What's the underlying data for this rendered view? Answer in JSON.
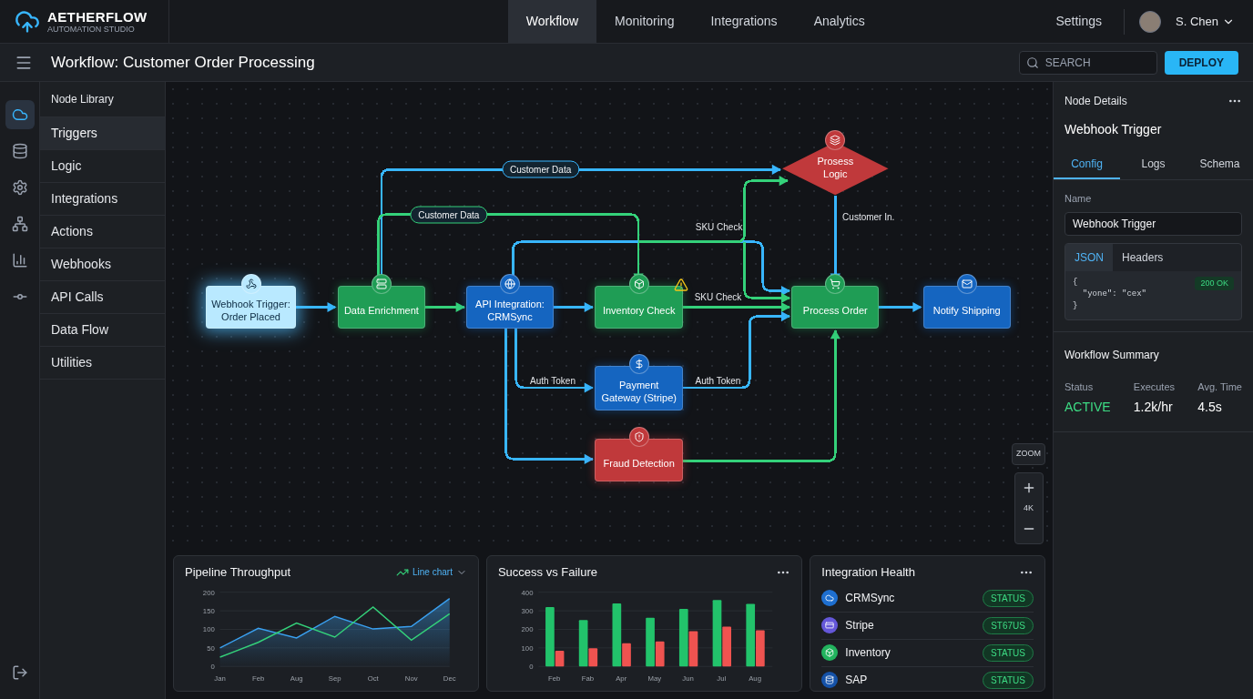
{
  "brand": {
    "name": "AETHERFLOW",
    "tagline": "AUTOMATION STUDIO"
  },
  "nav": [
    {
      "label": "Workflow",
      "selected": true
    },
    {
      "label": "Monitoring",
      "selected": false
    },
    {
      "label": "Integrations",
      "selected": false
    },
    {
      "label": "Analytics",
      "selected": false
    }
  ],
  "header_right": {
    "settings": "Settings",
    "user": "S. Chen"
  },
  "toolbar": {
    "title": "Workflow: Customer Order Processing",
    "search": {
      "placeholder": "SEARCH"
    },
    "deploy": "DEPLOY"
  },
  "rail": [
    {
      "selected": true
    },
    {
      "selected": false
    },
    {
      "selected": false
    },
    {
      "selected": false
    },
    {
      "selected": false
    },
    {
      "selected": false
    }
  ],
  "node_library": {
    "title": "Node Library",
    "items": [
      {
        "label": "Triggers",
        "selected": true
      },
      {
        "label": "Logic",
        "selected": false
      },
      {
        "label": "Integrations",
        "selected": false
      },
      {
        "label": "Actions",
        "selected": false
      },
      {
        "label": "Webhooks",
        "selected": false
      },
      {
        "label": "API Calls",
        "selected": false
      },
      {
        "label": "Data Flow",
        "selected": false
      },
      {
        "label": "Utilities",
        "selected": false
      }
    ]
  },
  "canvas": {
    "nodes": [
      {
        "kind": "rect",
        "label": "Webhook Trigger: Order Placed",
        "color": "#b9e9ff",
        "selected": true,
        "warning": false
      },
      {
        "kind": "rect",
        "label": "Data Enrichment",
        "color": "#1f9d55",
        "selected": false,
        "warning": false
      },
      {
        "kind": "rect",
        "label": "API Integration: CRMSync",
        "color": "#1565c0",
        "selected": false,
        "warning": false
      },
      {
        "kind": "rect",
        "label": "Inventory Check",
        "color": "#1f9d55",
        "selected": false,
        "warning": true
      },
      {
        "kind": "diamond",
        "label": "Prosess Logic",
        "color": "#c0393b",
        "selected": false,
        "warning": false
      },
      {
        "kind": "rect",
        "label": "Process Order",
        "color": "#1f9d55",
        "selected": false,
        "warning": false
      },
      {
        "kind": "rect",
        "label": "Notify Shipping",
        "color": "#1565c0",
        "selected": false,
        "warning": false
      },
      {
        "kind": "rect",
        "label": "Payment Gateway (Stripe)",
        "color": "#1565c0",
        "selected": false,
        "warning": false
      },
      {
        "kind": "rect",
        "label": "Fraud Detection",
        "color": "#c0393b",
        "selected": false,
        "warning": false
      }
    ],
    "edges": [
      {
        "color": "#38b6ff"
      },
      {
        "color": "#34d17a"
      },
      {
        "color": "#38b6ff"
      },
      {
        "color": "#38b6ff"
      },
      {
        "color": "#34d17a",
        "label": "SKU Check",
        "kind": "plain"
      },
      {
        "color": "#38b6ff",
        "label": "Customer Data",
        "kind": "pill"
      },
      {
        "color": "#34d17a",
        "label": "Customer Data",
        "kind": "pill"
      },
      {
        "color": "#38b6ff"
      },
      {
        "color": "#34d17a",
        "label": "SKU Check",
        "kind": "plain"
      },
      {
        "color": "#38b6ff",
        "label": "Customer In.",
        "kind": "plain"
      },
      {
        "color": "#38b6ff",
        "label": "Auth Token",
        "kind": "plain"
      },
      {
        "color": "#38b6ff"
      },
      {
        "color": "#38b6ff",
        "label": "Auth Token",
        "kind": "plain"
      },
      {
        "color": "#34d17a"
      }
    ],
    "zoom": {
      "label": "ZOOM",
      "level": "4K"
    }
  },
  "node_details": {
    "title": "Node Details",
    "node": "Webhook Trigger",
    "tabs": [
      {
        "label": "Config",
        "selected": true
      },
      {
        "label": "Logs",
        "selected": false
      },
      {
        "label": "Schema",
        "selected": false
      }
    ],
    "name_label": "Name",
    "name_value": "Webhook Trigger",
    "code_tabs": [
      {
        "label": "JSON",
        "selected": true
      },
      {
        "label": "Headers",
        "selected": false
      }
    ],
    "code_lines": [
      "{",
      "  \"yone\": \"cex\"",
      "}"
    ],
    "response": "200 OK"
  },
  "workflow_summary": {
    "title": "Workflow Summary",
    "stats": [
      {
        "label": "Status",
        "value": "ACTIVE",
        "kind": "status"
      },
      {
        "label": "Executes",
        "value": "1.2k/hr",
        "kind": "plain"
      },
      {
        "label": "Avg. Time",
        "value": "4.5s",
        "kind": "plain"
      }
    ]
  },
  "throughput": {
    "title": "Pipeline Throughput",
    "view": "Line chart",
    "chart_data": {
      "type": "area",
      "grid": true,
      "categories": [
        "Jan",
        "Feb",
        "Aug",
        "Sep",
        "Oct",
        "Nov",
        "Dec"
      ],
      "yticks": [
        0,
        50,
        100,
        150,
        200
      ],
      "ylim": [
        0,
        200
      ],
      "series": [
        {
          "color": "#3aa0f0",
          "values": [
            50,
            103,
            77,
            135,
            101,
            108,
            183
          ]
        },
        {
          "color": "#34d17a",
          "type": "line",
          "values": [
            25,
            65,
            117,
            79,
            160,
            71,
            142
          ]
        }
      ]
    }
  },
  "success_failure": {
    "title": "Success vs Failure",
    "chart_data": {
      "type": "bar",
      "grid": true,
      "categories": [
        "Feb",
        "Fab",
        "Apr",
        "May",
        "Jun",
        "Jul",
        "Aug"
      ],
      "yticks": [
        0,
        100,
        200,
        300,
        400
      ],
      "ylim": [
        0,
        400
      ],
      "series": [
        {
          "color": "#22c36b",
          "values": [
            320,
            250,
            340,
            263,
            310,
            358,
            338
          ]
        },
        {
          "color": "#ef5350",
          "values": [
            85,
            98,
            125,
            135,
            190,
            215,
            195
          ]
        }
      ]
    }
  },
  "integration_health": {
    "title": "Integration Health",
    "items": [
      {
        "name": "CRMSync",
        "status": "STATUS",
        "color": "#1e6fd0"
      },
      {
        "name": "Stripe",
        "status": "ST67US",
        "color": "#6457d9"
      },
      {
        "name": "Inventory",
        "status": "STATUS",
        "color": "#22b35e"
      },
      {
        "name": "SAP",
        "status": "STATUS",
        "color": "#1552a8"
      }
    ]
  }
}
